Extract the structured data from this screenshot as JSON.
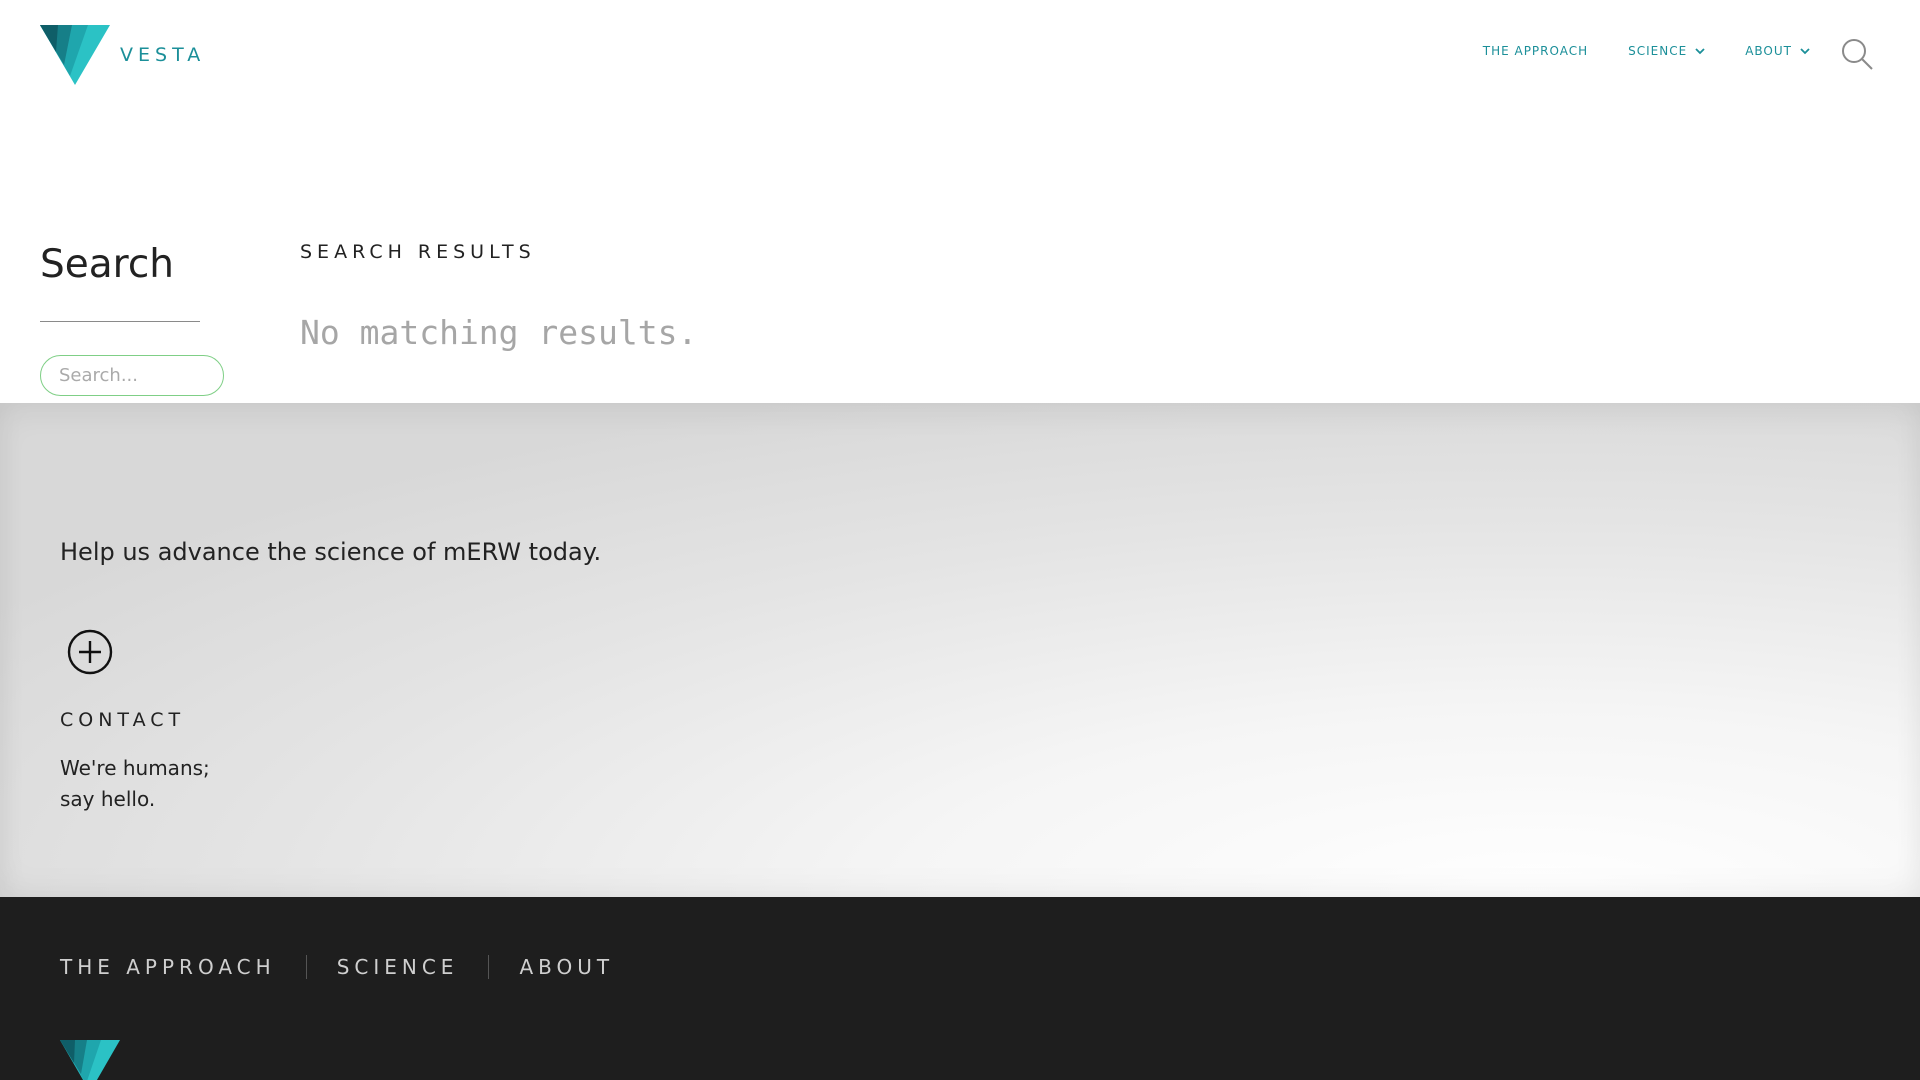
{
  "brand": {
    "name": "VESTA",
    "accent_color": "#1b8f99",
    "logo_icon": "vesta-triangle-icon"
  },
  "header": {
    "nav": [
      {
        "label": "THE APPROACH",
        "has_dropdown": false
      },
      {
        "label": "SCIENCE",
        "has_dropdown": true
      },
      {
        "label": "ABOUT",
        "has_dropdown": true
      }
    ],
    "search_icon": "search-icon"
  },
  "search": {
    "title": "Search",
    "input_placeholder": "Search...",
    "input_value": "",
    "input_border_color": "#7fcf86",
    "results_heading": "SEARCH RESULTS",
    "no_results_text": "No matching results."
  },
  "cta": {
    "text": "Help us advance the science of mERW today.",
    "icon": "plus-circle-icon",
    "contact_heading": "CONTACT",
    "contact_line_1": "We're humans;",
    "contact_line_2": "say hello."
  },
  "footer": {
    "background_color": "#1e1e1e",
    "links": [
      "THE APPROACH",
      "SCIENCE",
      "ABOUT"
    ],
    "logo_icon": "vesta-triangle-icon"
  }
}
